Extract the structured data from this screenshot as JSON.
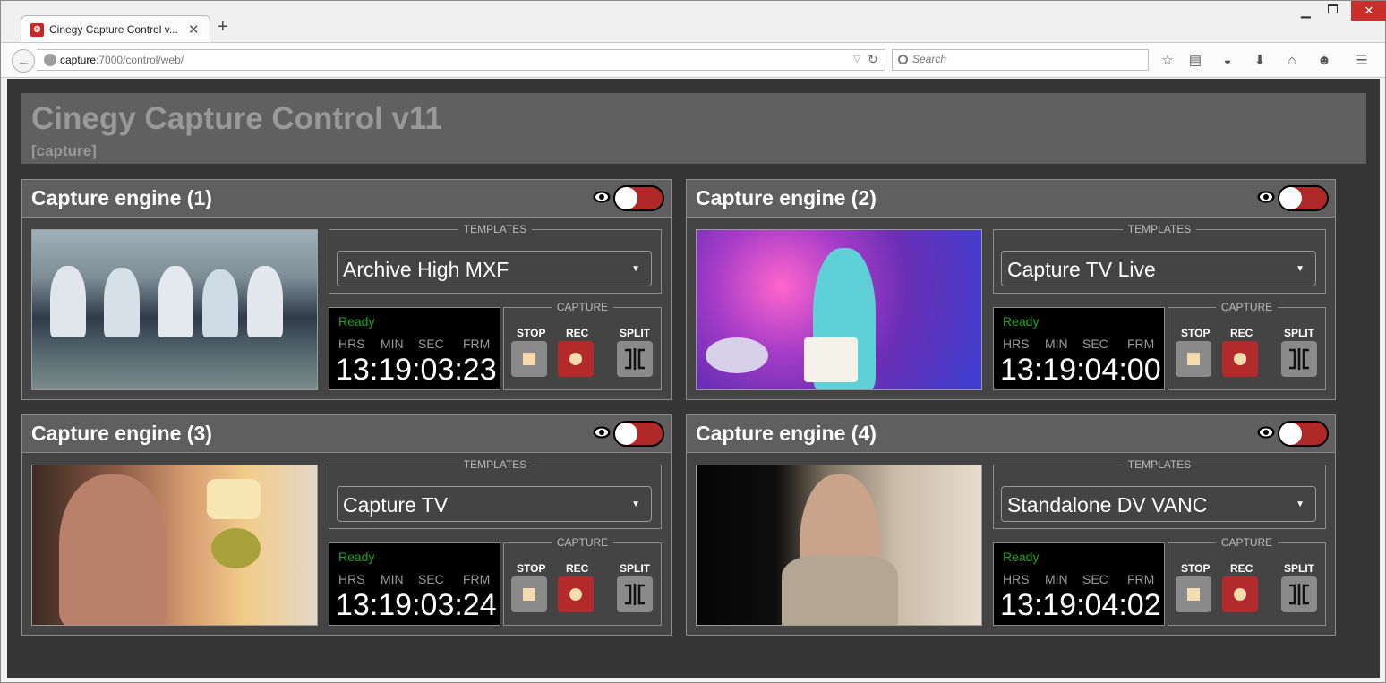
{
  "browser": {
    "tab_title": "Cinegy Capture Control v...",
    "url_host": "capture",
    "url_rest": ":7000/control/web/",
    "search_placeholder": "Search"
  },
  "app": {
    "title": "Cinegy Capture Control v11",
    "subtitle": "[capture]"
  },
  "labels": {
    "templates": "TEMPLATES",
    "capture": "CAPTURE",
    "hrs": "HRS",
    "min": "MIN",
    "sec": "SEC",
    "frm": "FRM",
    "stop": "STOP",
    "rec": "REC",
    "split": "SPLIT"
  },
  "colors": {
    "status_ready": "#1ea31e",
    "rec_button": "#b22a2a",
    "toggle_bg": "#b02828"
  },
  "engines": [
    {
      "title": "Capture engine (1)",
      "template": "Archive High MXF",
      "status": "Ready",
      "timecode": "13:19:03:23"
    },
    {
      "title": "Capture engine (2)",
      "template": "Capture TV Live",
      "status": "Ready",
      "timecode": "13:19:04:00"
    },
    {
      "title": "Capture engine (3)",
      "template": "Capture TV",
      "status": "Ready",
      "timecode": "13:19:03:24"
    },
    {
      "title": "Capture engine (4)",
      "template": "Standalone DV VANC",
      "status": "Ready",
      "timecode": "13:19:04:02"
    }
  ]
}
